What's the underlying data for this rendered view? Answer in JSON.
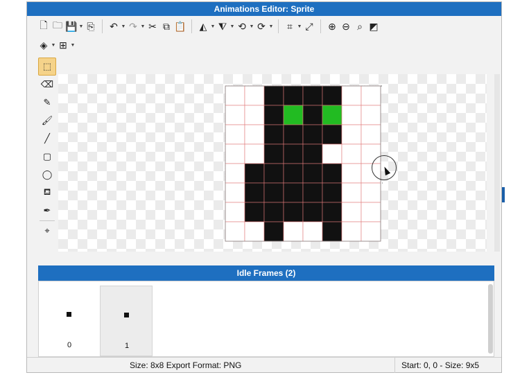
{
  "window": {
    "title": "Animations Editor: Sprite"
  },
  "toolbar": {
    "row1": [
      {
        "name": "new-file-icon",
        "glyph": "🗋"
      },
      {
        "name": "open-folder-icon",
        "glyph": "🗀"
      },
      {
        "name": "save-icon",
        "glyph": "💾",
        "caret": true
      },
      {
        "name": "export-icon",
        "glyph": "⎘"
      },
      {
        "sep": true
      },
      {
        "name": "undo-icon",
        "glyph": "↶",
        "caret": true
      },
      {
        "name": "redo-icon",
        "glyph": "↷",
        "caret": true,
        "muted": true
      },
      {
        "name": "cut-icon",
        "glyph": "✂"
      },
      {
        "name": "copy-icon",
        "glyph": "⧉"
      },
      {
        "name": "paste-icon",
        "glyph": "📋"
      },
      {
        "sep": true
      },
      {
        "name": "flip-horizontal-icon",
        "glyph": "◭",
        "caret": true
      },
      {
        "name": "flip-vertical-icon",
        "glyph": "⧨",
        "caret": true
      },
      {
        "name": "rotate-left-icon",
        "glyph": "⟲",
        "caret": true
      },
      {
        "name": "rotate-right-icon",
        "glyph": "⟳",
        "caret": true
      },
      {
        "sep": true
      },
      {
        "name": "crop-icon",
        "glyph": "⌗",
        "caret": true
      },
      {
        "name": "resize-icon",
        "glyph": "⤢"
      },
      {
        "sep": true
      },
      {
        "name": "zoom-in-icon",
        "glyph": "⊕"
      },
      {
        "name": "zoom-out-icon",
        "glyph": "⊖"
      },
      {
        "name": "zoom-fit-icon",
        "glyph": "⌕"
      },
      {
        "name": "toggle-background-icon",
        "glyph": "◩"
      }
    ],
    "row2": [
      {
        "name": "layers-icon",
        "glyph": "◈",
        "caret": true
      },
      {
        "name": "grid-icon",
        "glyph": "⊞",
        "caret": true
      }
    ]
  },
  "tools": [
    {
      "name": "select-tool-icon",
      "glyph": "⬚",
      "selected": true
    },
    {
      "name": "eraser-tool-icon",
      "glyph": "⌫"
    },
    {
      "name": "pencil-tool-icon",
      "glyph": "✎"
    },
    {
      "name": "brush-tool-icon",
      "glyph": "🖌"
    },
    {
      "name": "line-tool-icon",
      "glyph": "╱"
    },
    {
      "name": "rectangle-tool-icon",
      "glyph": "▢"
    },
    {
      "name": "ellipse-tool-icon",
      "glyph": "◯"
    },
    {
      "name": "fill-tool-icon",
      "glyph": "⛾"
    },
    {
      "name": "eyedropper-tool-icon",
      "glyph": "✒"
    },
    {
      "sep": true
    },
    {
      "name": "origin-tool-icon",
      "glyph": "⌖"
    }
  ],
  "sprite": {
    "cols": 8,
    "rows": 8,
    "colors": {
      "k": "#111111",
      "g": "#22bb22",
      "e": "transparent"
    },
    "pixels": [
      "eekkkkee",
      "eekgkgee",
      "eekkkkee",
      "eekkkeee",
      "ekkkkkee",
      "ekkkkkee",
      "ekkkkkee",
      "eekeekee"
    ],
    "grid_color": "#e07a7a",
    "selection": {
      "x": 0,
      "y": 0,
      "w": 9,
      "h": 5
    }
  },
  "frames": {
    "header": "Idle Frames (2)",
    "items": [
      {
        "label": "0",
        "selected": false
      },
      {
        "label": "1",
        "selected": true
      }
    ]
  },
  "status": {
    "left": "Size: 8x8   Export Format: PNG",
    "right": "Start: 0, 0 - Size: 9x5"
  }
}
